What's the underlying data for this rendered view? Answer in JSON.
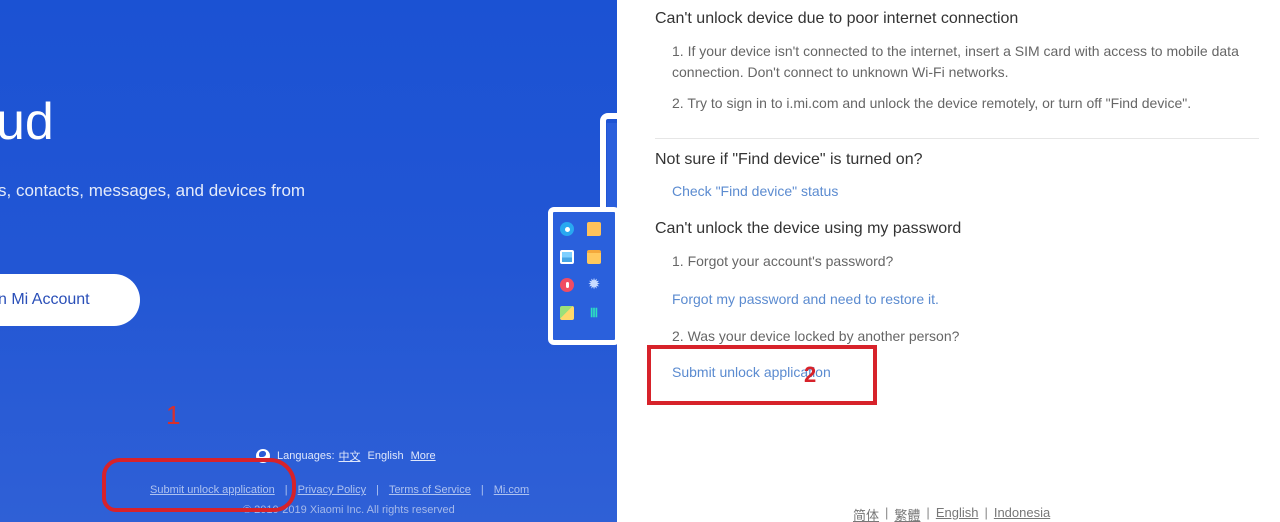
{
  "left_panel": {
    "hero_title": "ud",
    "hero_subtitle": "s, contacts, messages, and devices from",
    "signin_button": "n Mi Account",
    "device_apps": [
      "contacts-icon",
      "message-icon",
      "gallery-icon",
      "notes-icon",
      "recorder-icon",
      "settings-icon",
      "maps-icon",
      "trash-icon"
    ],
    "annotation_label": "1",
    "languages": {
      "label": "Languages:",
      "options": [
        "中文",
        "English",
        "More"
      ]
    },
    "footer_links": [
      "Submit unlock application",
      "Privacy Policy",
      "Terms of Service",
      "Mi.com"
    ],
    "separator": "|",
    "copyright": "© 2010-2019 Xiaomi Inc. All rights reserved"
  },
  "right_panel": {
    "sections": [
      {
        "heading": "Can't unlock device due to poor internet connection",
        "items": [
          "1. If your device isn't connected to the internet, insert a SIM card with access to mobile data connection. Don't connect to unknown Wi-Fi networks.",
          "2. Try to sign in to i.mi.com and unlock the device remotely, or turn off \"Find device\"."
        ]
      },
      {
        "heading": "Not sure if \"Find device\" is turned on?",
        "link": "Check \"Find device\" status"
      },
      {
        "heading": "Can't unlock the device using my password",
        "item1": "1. Forgot your account's password?",
        "link1": "Forgot my password and need to restore it.",
        "item2": "2. Was your device locked by another person?",
        "link2": "Submit unlock application"
      }
    ],
    "annotation_label": "2",
    "bottom_languages": [
      "简体",
      "繁體",
      "English",
      "Indonesia"
    ],
    "separator": "|"
  },
  "colors": {
    "brand_blue": "#1b52d3",
    "link_blue": "#5b8bd0",
    "annotation_red": "#d7222a"
  }
}
